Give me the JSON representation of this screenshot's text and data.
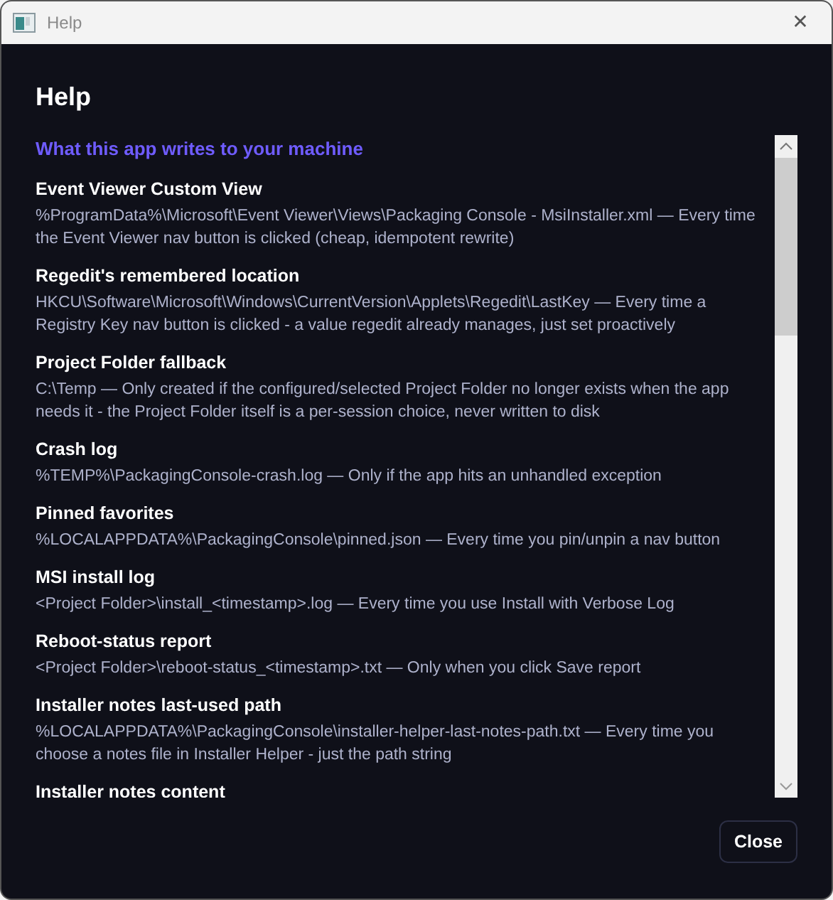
{
  "window": {
    "title": "Help",
    "close_glyph": "✕"
  },
  "heading": "Help",
  "section": {
    "title": "What this app writes to your machine",
    "items": [
      {
        "title": "Event Viewer Custom View",
        "description": "%ProgramData%\\Microsoft\\Event Viewer\\Views\\Packaging Console - MsiInstaller.xml — Every time the Event Viewer nav button is clicked (cheap, idempotent rewrite)"
      },
      {
        "title": "Regedit's remembered location",
        "description": "HKCU\\Software\\Microsoft\\Windows\\CurrentVersion\\Applets\\Regedit\\LastKey — Every time a Registry Key nav button is clicked - a value regedit already manages, just set proactively"
      },
      {
        "title": "Project Folder fallback",
        "description": "C:\\Temp — Only created if the configured/selected Project Folder no longer exists when the app needs it - the Project Folder itself is a per-session choice, never written to disk"
      },
      {
        "title": "Crash log",
        "description": "%TEMP%\\PackagingConsole-crash.log — Only if the app hits an unhandled exception"
      },
      {
        "title": "Pinned favorites",
        "description": "%LOCALAPPDATA%\\PackagingConsole\\pinned.json — Every time you pin/unpin a nav button"
      },
      {
        "title": "MSI install log",
        "description": "<Project Folder>\\install_<timestamp>.log — Every time you use Install with Verbose Log"
      },
      {
        "title": "Reboot-status report",
        "description": "<Project Folder>\\reboot-status_<timestamp>.txt — Only when you click Save report"
      },
      {
        "title": "Installer notes last-used path",
        "description": "%LOCALAPPDATA%\\PackagingConsole\\installer-helper-last-notes-path.txt — Every time you choose a notes file in Installer Helper - just the path string"
      },
      {
        "title": "Installer notes content"
      }
    ]
  },
  "buttons": [
    {
      "label": "Close"
    }
  ]
}
